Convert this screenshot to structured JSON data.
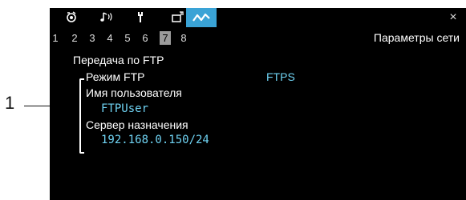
{
  "callout": {
    "number": "1"
  },
  "tabs": [
    {
      "icon": "camera-settings-icon"
    },
    {
      "icon": "audio-icon"
    },
    {
      "icon": "wrench-icon"
    },
    {
      "icon": "assign-button-icon"
    },
    {
      "icon": "network-icon",
      "active": true
    }
  ],
  "close_label": "×",
  "pages": [
    "1",
    "2",
    "3",
    "4",
    "5",
    "6",
    "7",
    "8"
  ],
  "current_page": "7",
  "page_title": "Параметры сети",
  "section_title": "Передача по FTP",
  "items": {
    "ftp_mode": {
      "label": "Режим FTP",
      "value": "FTPS"
    },
    "username": {
      "label": "Имя пользователя",
      "value": "FTPUser"
    },
    "server": {
      "label": "Сервер назначения",
      "value": "192.168.0.150/24"
    }
  },
  "colors": {
    "accent": "#3aa3d6",
    "value_text": "#6fd3f3",
    "background": "#000000"
  }
}
